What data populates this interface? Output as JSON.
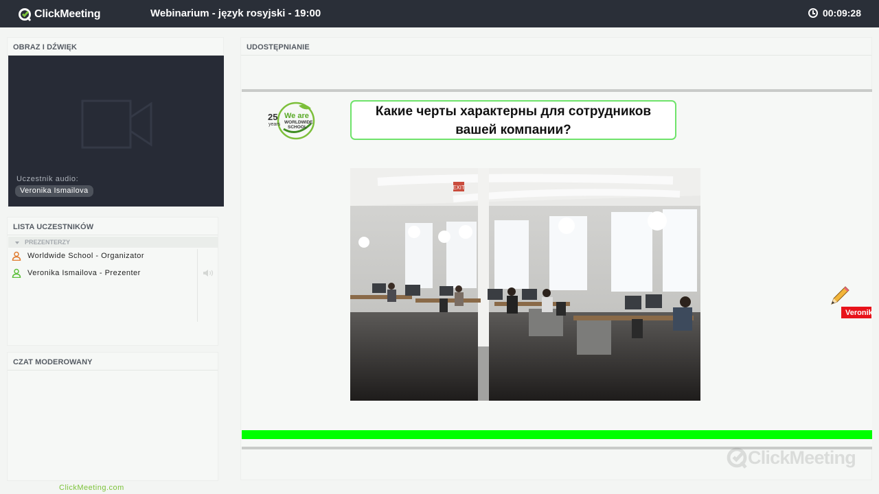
{
  "topbar": {
    "logo_text": "ClickMeeting",
    "title": "Webinarium - język rosyjski - 19:00",
    "timer": "00:09:28"
  },
  "av_panel": {
    "header": "OBRAZ I DŹWIĘK",
    "audio_label": "Uczestnik audio:",
    "audio_participant": "Veronika Ismailova"
  },
  "participants": {
    "header": "LISTA UCZESTNIKÓW",
    "group_label": "PREZENTERZY",
    "items": [
      {
        "label": "Worldwide School - Organizator",
        "icon": "organizer-user-icon",
        "color": "#e07b2e"
      },
      {
        "label": "Veronika Ismailova - Prezenter",
        "icon": "presenter-user-icon",
        "color": "#5cbf3b"
      }
    ]
  },
  "chat": {
    "header": "CZAT MODEROWANY"
  },
  "footer": {
    "link": "ClickMeeting.com"
  },
  "share": {
    "header": "UDOSTĘPNIANIE",
    "slide": {
      "logo_years": "25",
      "logo_years_label": "years",
      "logo_we_are": "We are",
      "logo_school1": "WORLDWIDE",
      "logo_school2": "SCHOOL",
      "question_line1": "Какие черты характерны для сотрудников",
      "question_line2": "вашей компании?",
      "photo_exit_sign": "EXIT"
    },
    "cursor_name": "Veronika Ismailova",
    "watermark": "ClickMeeting"
  },
  "colors": {
    "topbar_bg": "#2a2f38",
    "brand_green": "#7cc23a",
    "slide_bar": "#00ff00",
    "cursor_tag": "#e8131b"
  }
}
